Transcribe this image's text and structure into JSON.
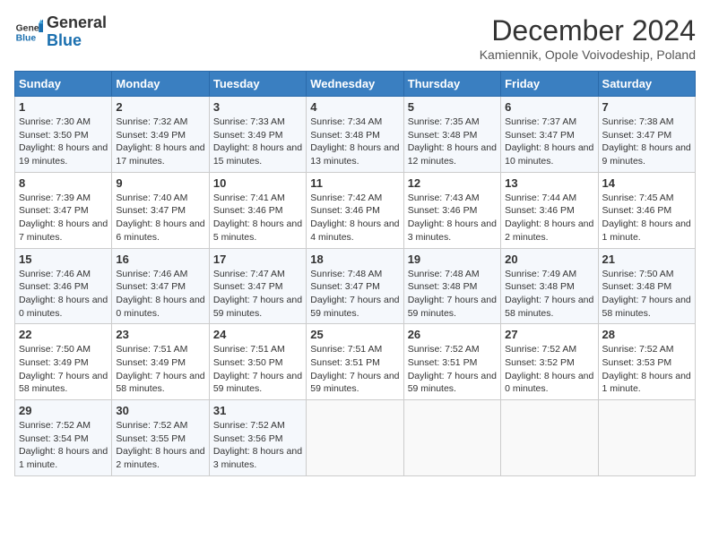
{
  "header": {
    "logo_general": "General",
    "logo_blue": "Blue",
    "title": "December 2024",
    "subtitle": "Kamiennik, Opole Voivodeship, Poland"
  },
  "calendar": {
    "headers": [
      "Sunday",
      "Monday",
      "Tuesday",
      "Wednesday",
      "Thursday",
      "Friday",
      "Saturday"
    ],
    "weeks": [
      [
        {
          "day": "1",
          "info": "Sunrise: 7:30 AM\nSunset: 3:50 PM\nDaylight: 8 hours and 19 minutes."
        },
        {
          "day": "2",
          "info": "Sunrise: 7:32 AM\nSunset: 3:49 PM\nDaylight: 8 hours and 17 minutes."
        },
        {
          "day": "3",
          "info": "Sunrise: 7:33 AM\nSunset: 3:49 PM\nDaylight: 8 hours and 15 minutes."
        },
        {
          "day": "4",
          "info": "Sunrise: 7:34 AM\nSunset: 3:48 PM\nDaylight: 8 hours and 13 minutes."
        },
        {
          "day": "5",
          "info": "Sunrise: 7:35 AM\nSunset: 3:48 PM\nDaylight: 8 hours and 12 minutes."
        },
        {
          "day": "6",
          "info": "Sunrise: 7:37 AM\nSunset: 3:47 PM\nDaylight: 8 hours and 10 minutes."
        },
        {
          "day": "7",
          "info": "Sunrise: 7:38 AM\nSunset: 3:47 PM\nDaylight: 8 hours and 9 minutes."
        }
      ],
      [
        {
          "day": "8",
          "info": "Sunrise: 7:39 AM\nSunset: 3:47 PM\nDaylight: 8 hours and 7 minutes."
        },
        {
          "day": "9",
          "info": "Sunrise: 7:40 AM\nSunset: 3:47 PM\nDaylight: 8 hours and 6 minutes."
        },
        {
          "day": "10",
          "info": "Sunrise: 7:41 AM\nSunset: 3:46 PM\nDaylight: 8 hours and 5 minutes."
        },
        {
          "day": "11",
          "info": "Sunrise: 7:42 AM\nSunset: 3:46 PM\nDaylight: 8 hours and 4 minutes."
        },
        {
          "day": "12",
          "info": "Sunrise: 7:43 AM\nSunset: 3:46 PM\nDaylight: 8 hours and 3 minutes."
        },
        {
          "day": "13",
          "info": "Sunrise: 7:44 AM\nSunset: 3:46 PM\nDaylight: 8 hours and 2 minutes."
        },
        {
          "day": "14",
          "info": "Sunrise: 7:45 AM\nSunset: 3:46 PM\nDaylight: 8 hours and 1 minute."
        }
      ],
      [
        {
          "day": "15",
          "info": "Sunrise: 7:46 AM\nSunset: 3:46 PM\nDaylight: 8 hours and 0 minutes."
        },
        {
          "day": "16",
          "info": "Sunrise: 7:46 AM\nSunset: 3:47 PM\nDaylight: 8 hours and 0 minutes."
        },
        {
          "day": "17",
          "info": "Sunrise: 7:47 AM\nSunset: 3:47 PM\nDaylight: 7 hours and 59 minutes."
        },
        {
          "day": "18",
          "info": "Sunrise: 7:48 AM\nSunset: 3:47 PM\nDaylight: 7 hours and 59 minutes."
        },
        {
          "day": "19",
          "info": "Sunrise: 7:48 AM\nSunset: 3:48 PM\nDaylight: 7 hours and 59 minutes."
        },
        {
          "day": "20",
          "info": "Sunrise: 7:49 AM\nSunset: 3:48 PM\nDaylight: 7 hours and 58 minutes."
        },
        {
          "day": "21",
          "info": "Sunrise: 7:50 AM\nSunset: 3:48 PM\nDaylight: 7 hours and 58 minutes."
        }
      ],
      [
        {
          "day": "22",
          "info": "Sunrise: 7:50 AM\nSunset: 3:49 PM\nDaylight: 7 hours and 58 minutes."
        },
        {
          "day": "23",
          "info": "Sunrise: 7:51 AM\nSunset: 3:49 PM\nDaylight: 7 hours and 58 minutes."
        },
        {
          "day": "24",
          "info": "Sunrise: 7:51 AM\nSunset: 3:50 PM\nDaylight: 7 hours and 59 minutes."
        },
        {
          "day": "25",
          "info": "Sunrise: 7:51 AM\nSunset: 3:51 PM\nDaylight: 7 hours and 59 minutes."
        },
        {
          "day": "26",
          "info": "Sunrise: 7:52 AM\nSunset: 3:51 PM\nDaylight: 7 hours and 59 minutes."
        },
        {
          "day": "27",
          "info": "Sunrise: 7:52 AM\nSunset: 3:52 PM\nDaylight: 8 hours and 0 minutes."
        },
        {
          "day": "28",
          "info": "Sunrise: 7:52 AM\nSunset: 3:53 PM\nDaylight: 8 hours and 1 minute."
        }
      ],
      [
        {
          "day": "29",
          "info": "Sunrise: 7:52 AM\nSunset: 3:54 PM\nDaylight: 8 hours and 1 minute."
        },
        {
          "day": "30",
          "info": "Sunrise: 7:52 AM\nSunset: 3:55 PM\nDaylight: 8 hours and 2 minutes."
        },
        {
          "day": "31",
          "info": "Sunrise: 7:52 AM\nSunset: 3:56 PM\nDaylight: 8 hours and 3 minutes."
        },
        null,
        null,
        null,
        null
      ]
    ]
  }
}
